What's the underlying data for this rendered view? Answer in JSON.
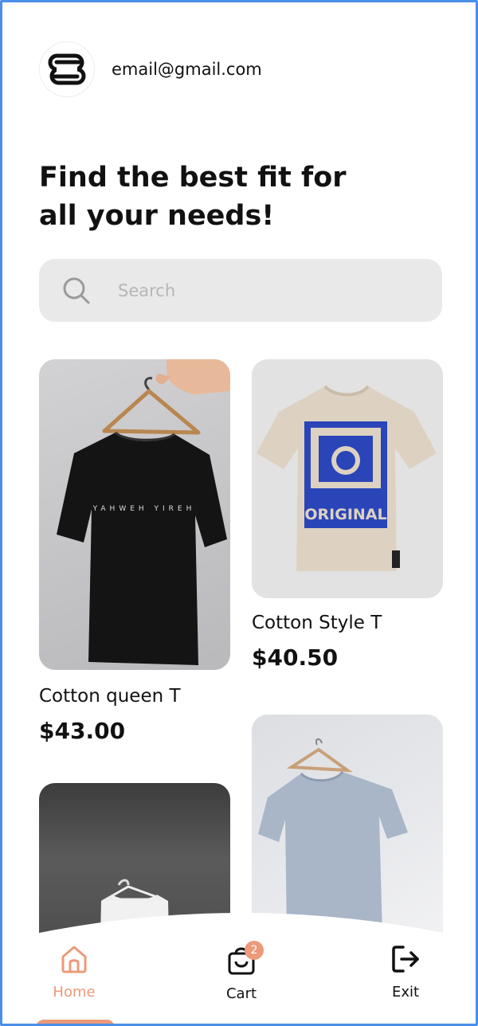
{
  "user": {
    "email": "email@gmail.com",
    "logo_icon": "brand-logo-icon"
  },
  "headline": "Find the best fit for all your needs!",
  "search": {
    "placeholder": "Search",
    "icon": "search-icon"
  },
  "products": [
    {
      "name": "Cotton queen T",
      "price": "$43.00",
      "image": "black-tshirt-on-hanger",
      "shirt_text": "YAHWEH YIREH"
    },
    {
      "name": "Cotton Style T",
      "price": "$40.50",
      "image": "beige-tshirt-cat-print",
      "shirt_text": "ORIGINAL"
    },
    {
      "name": "",
      "price": "",
      "image": "white-tshirt-dark-wall"
    },
    {
      "name": "",
      "price": "",
      "image": "grey-tshirt-on-hanger"
    }
  ],
  "nav": {
    "items": [
      {
        "label": "Home",
        "icon": "home-icon",
        "active": true
      },
      {
        "label": "Cart",
        "icon": "cart-icon",
        "badge": "2"
      },
      {
        "label": "Exit",
        "icon": "exit-icon"
      }
    ]
  },
  "colors": {
    "accent": "#ec9a7a",
    "search_bg": "#e9e9e9",
    "frame_border": "#4b8fe8",
    "print_blue": "#2a45b8"
  }
}
